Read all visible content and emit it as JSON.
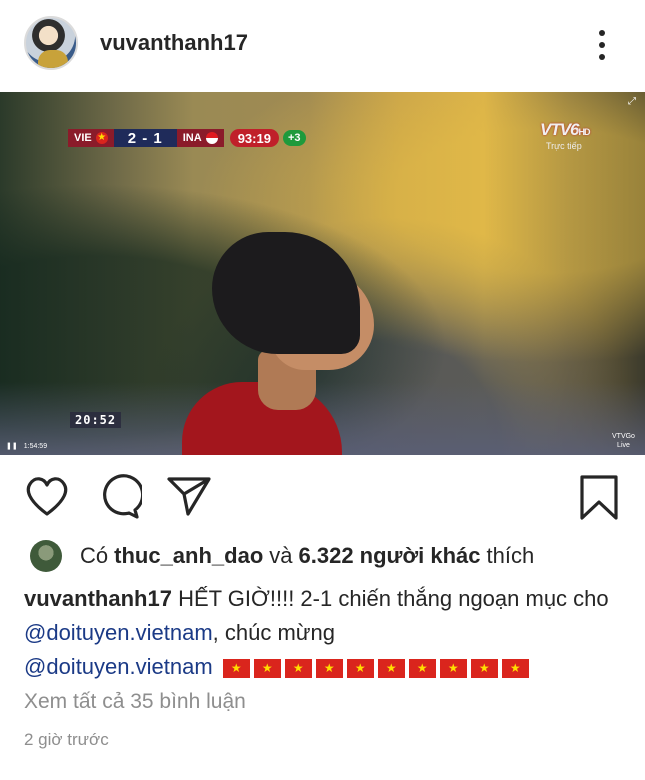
{
  "header": {
    "username": "vuvanthanh17",
    "more_icon": "more-vertical-icon"
  },
  "media": {
    "overlay": {
      "team_home": "VIE",
      "score": "2 - 1",
      "team_away": "INA",
      "match_clock": "93:19",
      "added_time": "+3",
      "broadcaster": "VTV6",
      "broadcaster_sub": "HD",
      "live_label": "Trực tiếp",
      "clip_timer": "20:52",
      "playback_time": "1:54:59",
      "corner_logo": "VTVGo",
      "corner_live": "Live"
    }
  },
  "actions": {
    "like_icon": "heart-icon",
    "comment_icon": "comment-icon",
    "share_icon": "send-icon",
    "save_icon": "bookmark-icon"
  },
  "likes": {
    "prefix": "Có",
    "liker": "thuc_anh_dao",
    "connector": "và",
    "others": "6.322 người khác",
    "suffix": "thích"
  },
  "caption": {
    "author": "vuvanthanh17",
    "text_1": "HẾT GIỜ!!!! 2-1 chiến thắng ngoạn mục cho",
    "mention_1": "@doituyen.vietnam",
    "text_2": ", chúc mừng",
    "mention_2": "@doituyen.vietnam",
    "flag_emoji": "🇻🇳",
    "flag_count": 10
  },
  "comments": {
    "view_all": "Xem tất cả 35 bình luận"
  },
  "timestamp": "2 giờ trước"
}
